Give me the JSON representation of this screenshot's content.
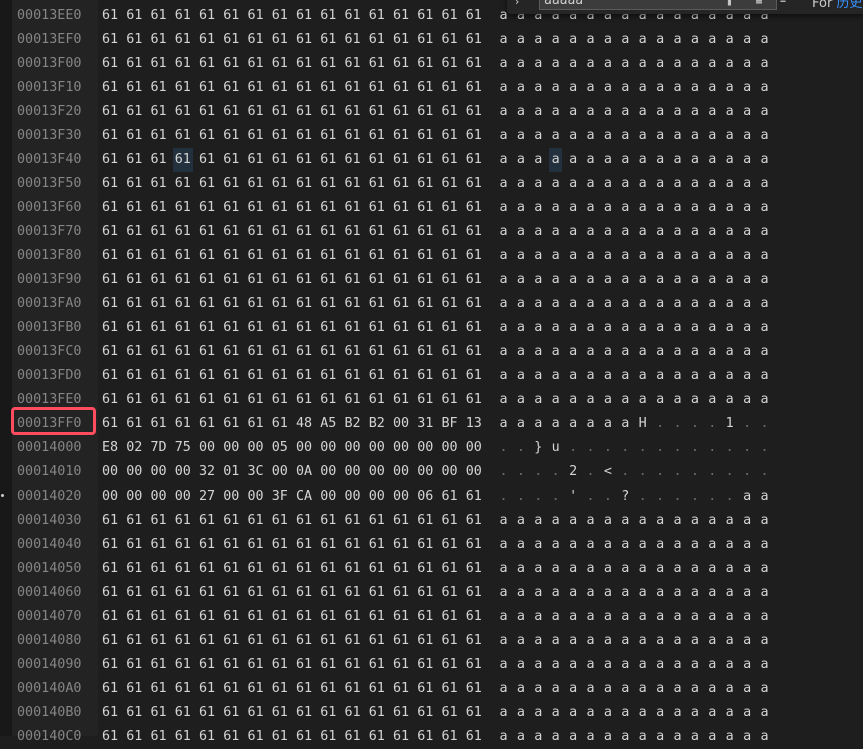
{
  "find": {
    "query": "aaaaa",
    "label_prefix": "For ",
    "label_accent": "历史"
  },
  "highlight_address": "00013FF0",
  "selected_offset": "00013F43",
  "rows": [
    {
      "addr": "00013EE0",
      "hex": [
        "61",
        "61",
        "61",
        "61",
        "61",
        "61",
        "61",
        "61",
        "61",
        "61",
        "61",
        "61",
        "61",
        "61",
        "61",
        "61"
      ],
      "ascii": [
        "a",
        "a",
        "a",
        "a",
        "a",
        "a",
        "a",
        "a",
        "a",
        "a",
        "a",
        "a",
        "a",
        "a",
        "a",
        "a"
      ]
    },
    {
      "addr": "00013EF0",
      "hex": [
        "61",
        "61",
        "61",
        "61",
        "61",
        "61",
        "61",
        "61",
        "61",
        "61",
        "61",
        "61",
        "61",
        "61",
        "61",
        "61"
      ],
      "ascii": [
        "a",
        "a",
        "a",
        "a",
        "a",
        "a",
        "a",
        "a",
        "a",
        "a",
        "a",
        "a",
        "a",
        "a",
        "a",
        "a"
      ]
    },
    {
      "addr": "00013F00",
      "hex": [
        "61",
        "61",
        "61",
        "61",
        "61",
        "61",
        "61",
        "61",
        "61",
        "61",
        "61",
        "61",
        "61",
        "61",
        "61",
        "61"
      ],
      "ascii": [
        "a",
        "a",
        "a",
        "a",
        "a",
        "a",
        "a",
        "a",
        "a",
        "a",
        "a",
        "a",
        "a",
        "a",
        "a",
        "a"
      ]
    },
    {
      "addr": "00013F10",
      "hex": [
        "61",
        "61",
        "61",
        "61",
        "61",
        "61",
        "61",
        "61",
        "61",
        "61",
        "61",
        "61",
        "61",
        "61",
        "61",
        "61"
      ],
      "ascii": [
        "a",
        "a",
        "a",
        "a",
        "a",
        "a",
        "a",
        "a",
        "a",
        "a",
        "a",
        "a",
        "a",
        "a",
        "a",
        "a"
      ]
    },
    {
      "addr": "00013F20",
      "hex": [
        "61",
        "61",
        "61",
        "61",
        "61",
        "61",
        "61",
        "61",
        "61",
        "61",
        "61",
        "61",
        "61",
        "61",
        "61",
        "61"
      ],
      "ascii": [
        "a",
        "a",
        "a",
        "a",
        "a",
        "a",
        "a",
        "a",
        "a",
        "a",
        "a",
        "a",
        "a",
        "a",
        "a",
        "a"
      ]
    },
    {
      "addr": "00013F30",
      "hex": [
        "61",
        "61",
        "61",
        "61",
        "61",
        "61",
        "61",
        "61",
        "61",
        "61",
        "61",
        "61",
        "61",
        "61",
        "61",
        "61"
      ],
      "ascii": [
        "a",
        "a",
        "a",
        "a",
        "a",
        "a",
        "a",
        "a",
        "a",
        "a",
        "a",
        "a",
        "a",
        "a",
        "a",
        "a"
      ]
    },
    {
      "addr": "00013F40",
      "hex": [
        "61",
        "61",
        "61",
        "61",
        "61",
        "61",
        "61",
        "61",
        "61",
        "61",
        "61",
        "61",
        "61",
        "61",
        "61",
        "61"
      ],
      "ascii": [
        "a",
        "a",
        "a",
        "a",
        "a",
        "a",
        "a",
        "a",
        "a",
        "a",
        "a",
        "a",
        "a",
        "a",
        "a",
        "a"
      ]
    },
    {
      "addr": "00013F50",
      "hex": [
        "61",
        "61",
        "61",
        "61",
        "61",
        "61",
        "61",
        "61",
        "61",
        "61",
        "61",
        "61",
        "61",
        "61",
        "61",
        "61"
      ],
      "ascii": [
        "a",
        "a",
        "a",
        "a",
        "a",
        "a",
        "a",
        "a",
        "a",
        "a",
        "a",
        "a",
        "a",
        "a",
        "a",
        "a"
      ]
    },
    {
      "addr": "00013F60",
      "hex": [
        "61",
        "61",
        "61",
        "61",
        "61",
        "61",
        "61",
        "61",
        "61",
        "61",
        "61",
        "61",
        "61",
        "61",
        "61",
        "61"
      ],
      "ascii": [
        "a",
        "a",
        "a",
        "a",
        "a",
        "a",
        "a",
        "a",
        "a",
        "a",
        "a",
        "a",
        "a",
        "a",
        "a",
        "a"
      ]
    },
    {
      "addr": "00013F70",
      "hex": [
        "61",
        "61",
        "61",
        "61",
        "61",
        "61",
        "61",
        "61",
        "61",
        "61",
        "61",
        "61",
        "61",
        "61",
        "61",
        "61"
      ],
      "ascii": [
        "a",
        "a",
        "a",
        "a",
        "a",
        "a",
        "a",
        "a",
        "a",
        "a",
        "a",
        "a",
        "a",
        "a",
        "a",
        "a"
      ]
    },
    {
      "addr": "00013F80",
      "hex": [
        "61",
        "61",
        "61",
        "61",
        "61",
        "61",
        "61",
        "61",
        "61",
        "61",
        "61",
        "61",
        "61",
        "61",
        "61",
        "61"
      ],
      "ascii": [
        "a",
        "a",
        "a",
        "a",
        "a",
        "a",
        "a",
        "a",
        "a",
        "a",
        "a",
        "a",
        "a",
        "a",
        "a",
        "a"
      ]
    },
    {
      "addr": "00013F90",
      "hex": [
        "61",
        "61",
        "61",
        "61",
        "61",
        "61",
        "61",
        "61",
        "61",
        "61",
        "61",
        "61",
        "61",
        "61",
        "61",
        "61"
      ],
      "ascii": [
        "a",
        "a",
        "a",
        "a",
        "a",
        "a",
        "a",
        "a",
        "a",
        "a",
        "a",
        "a",
        "a",
        "a",
        "a",
        "a"
      ]
    },
    {
      "addr": "00013FA0",
      "hex": [
        "61",
        "61",
        "61",
        "61",
        "61",
        "61",
        "61",
        "61",
        "61",
        "61",
        "61",
        "61",
        "61",
        "61",
        "61",
        "61"
      ],
      "ascii": [
        "a",
        "a",
        "a",
        "a",
        "a",
        "a",
        "a",
        "a",
        "a",
        "a",
        "a",
        "a",
        "a",
        "a",
        "a",
        "a"
      ]
    },
    {
      "addr": "00013FB0",
      "hex": [
        "61",
        "61",
        "61",
        "61",
        "61",
        "61",
        "61",
        "61",
        "61",
        "61",
        "61",
        "61",
        "61",
        "61",
        "61",
        "61"
      ],
      "ascii": [
        "a",
        "a",
        "a",
        "a",
        "a",
        "a",
        "a",
        "a",
        "a",
        "a",
        "a",
        "a",
        "a",
        "a",
        "a",
        "a"
      ]
    },
    {
      "addr": "00013FC0",
      "hex": [
        "61",
        "61",
        "61",
        "61",
        "61",
        "61",
        "61",
        "61",
        "61",
        "61",
        "61",
        "61",
        "61",
        "61",
        "61",
        "61"
      ],
      "ascii": [
        "a",
        "a",
        "a",
        "a",
        "a",
        "a",
        "a",
        "a",
        "a",
        "a",
        "a",
        "a",
        "a",
        "a",
        "a",
        "a"
      ]
    },
    {
      "addr": "00013FD0",
      "hex": [
        "61",
        "61",
        "61",
        "61",
        "61",
        "61",
        "61",
        "61",
        "61",
        "61",
        "61",
        "61",
        "61",
        "61",
        "61",
        "61"
      ],
      "ascii": [
        "a",
        "a",
        "a",
        "a",
        "a",
        "a",
        "a",
        "a",
        "a",
        "a",
        "a",
        "a",
        "a",
        "a",
        "a",
        "a"
      ]
    },
    {
      "addr": "00013FE0",
      "hex": [
        "61",
        "61",
        "61",
        "61",
        "61",
        "61",
        "61",
        "61",
        "61",
        "61",
        "61",
        "61",
        "61",
        "61",
        "61",
        "61"
      ],
      "ascii": [
        "a",
        "a",
        "a",
        "a",
        "a",
        "a",
        "a",
        "a",
        "a",
        "a",
        "a",
        "a",
        "a",
        "a",
        "a",
        "a"
      ]
    },
    {
      "addr": "00013FF0",
      "hex": [
        "61",
        "61",
        "61",
        "61",
        "61",
        "61",
        "61",
        "61",
        "48",
        "A5",
        "B2",
        "B2",
        "00",
        "31",
        "BF",
        "13"
      ],
      "ascii": [
        "a",
        "a",
        "a",
        "a",
        "a",
        "a",
        "a",
        "a",
        "H",
        ".",
        ".",
        ".",
        ".",
        "1",
        ".",
        "."
      ]
    },
    {
      "addr": "00014000",
      "hex": [
        "E8",
        "02",
        "7D",
        "75",
        "00",
        "00",
        "00",
        "05",
        "00",
        "00",
        "00",
        "00",
        "00",
        "00",
        "00",
        "00"
      ],
      "ascii": [
        ".",
        ".",
        "}",
        "u",
        ".",
        ".",
        ".",
        ".",
        ".",
        ".",
        ".",
        ".",
        ".",
        ".",
        ".",
        "."
      ]
    },
    {
      "addr": "00014010",
      "hex": [
        "00",
        "00",
        "00",
        "00",
        "32",
        "01",
        "3C",
        "00",
        "0A",
        "00",
        "00",
        "00",
        "00",
        "00",
        "00",
        "00"
      ],
      "ascii": [
        ".",
        ".",
        ".",
        ".",
        "2",
        ".",
        "<",
        ".",
        ".",
        ".",
        ".",
        ".",
        ".",
        ".",
        ".",
        "."
      ]
    },
    {
      "addr": "00014020",
      "hex": [
        "00",
        "00",
        "00",
        "00",
        "27",
        "00",
        "00",
        "3F",
        "CA",
        "00",
        "00",
        "00",
        "00",
        "06",
        "61",
        "61"
      ],
      "ascii": [
        ".",
        ".",
        ".",
        ".",
        "'",
        ".",
        ".",
        "?",
        ".",
        ".",
        ".",
        ".",
        ".",
        ".",
        "a",
        "a"
      ]
    },
    {
      "addr": "00014030",
      "hex": [
        "61",
        "61",
        "61",
        "61",
        "61",
        "61",
        "61",
        "61",
        "61",
        "61",
        "61",
        "61",
        "61",
        "61",
        "61",
        "61"
      ],
      "ascii": [
        "a",
        "a",
        "a",
        "a",
        "a",
        "a",
        "a",
        "a",
        "a",
        "a",
        "a",
        "a",
        "a",
        "a",
        "a",
        "a"
      ]
    },
    {
      "addr": "00014040",
      "hex": [
        "61",
        "61",
        "61",
        "61",
        "61",
        "61",
        "61",
        "61",
        "61",
        "61",
        "61",
        "61",
        "61",
        "61",
        "61",
        "61"
      ],
      "ascii": [
        "a",
        "a",
        "a",
        "a",
        "a",
        "a",
        "a",
        "a",
        "a",
        "a",
        "a",
        "a",
        "a",
        "a",
        "a",
        "a"
      ]
    },
    {
      "addr": "00014050",
      "hex": [
        "61",
        "61",
        "61",
        "61",
        "61",
        "61",
        "61",
        "61",
        "61",
        "61",
        "61",
        "61",
        "61",
        "61",
        "61",
        "61"
      ],
      "ascii": [
        "a",
        "a",
        "a",
        "a",
        "a",
        "a",
        "a",
        "a",
        "a",
        "a",
        "a",
        "a",
        "a",
        "a",
        "a",
        "a"
      ]
    },
    {
      "addr": "00014060",
      "hex": [
        "61",
        "61",
        "61",
        "61",
        "61",
        "61",
        "61",
        "61",
        "61",
        "61",
        "61",
        "61",
        "61",
        "61",
        "61",
        "61"
      ],
      "ascii": [
        "a",
        "a",
        "a",
        "a",
        "a",
        "a",
        "a",
        "a",
        "a",
        "a",
        "a",
        "a",
        "a",
        "a",
        "a",
        "a"
      ]
    },
    {
      "addr": "00014070",
      "hex": [
        "61",
        "61",
        "61",
        "61",
        "61",
        "61",
        "61",
        "61",
        "61",
        "61",
        "61",
        "61",
        "61",
        "61",
        "61",
        "61"
      ],
      "ascii": [
        "a",
        "a",
        "a",
        "a",
        "a",
        "a",
        "a",
        "a",
        "a",
        "a",
        "a",
        "a",
        "a",
        "a",
        "a",
        "a"
      ]
    },
    {
      "addr": "00014080",
      "hex": [
        "61",
        "61",
        "61",
        "61",
        "61",
        "61",
        "61",
        "61",
        "61",
        "61",
        "61",
        "61",
        "61",
        "61",
        "61",
        "61"
      ],
      "ascii": [
        "a",
        "a",
        "a",
        "a",
        "a",
        "a",
        "a",
        "a",
        "a",
        "a",
        "a",
        "a",
        "a",
        "a",
        "a",
        "a"
      ]
    },
    {
      "addr": "00014090",
      "hex": [
        "61",
        "61",
        "61",
        "61",
        "61",
        "61",
        "61",
        "61",
        "61",
        "61",
        "61",
        "61",
        "61",
        "61",
        "61",
        "61"
      ],
      "ascii": [
        "a",
        "a",
        "a",
        "a",
        "a",
        "a",
        "a",
        "a",
        "a",
        "a",
        "a",
        "a",
        "a",
        "a",
        "a",
        "a"
      ]
    },
    {
      "addr": "000140A0",
      "hex": [
        "61",
        "61",
        "61",
        "61",
        "61",
        "61",
        "61",
        "61",
        "61",
        "61",
        "61",
        "61",
        "61",
        "61",
        "61",
        "61"
      ],
      "ascii": [
        "a",
        "a",
        "a",
        "a",
        "a",
        "a",
        "a",
        "a",
        "a",
        "a",
        "a",
        "a",
        "a",
        "a",
        "a",
        "a"
      ]
    },
    {
      "addr": "000140B0",
      "hex": [
        "61",
        "61",
        "61",
        "61",
        "61",
        "61",
        "61",
        "61",
        "61",
        "61",
        "61",
        "61",
        "61",
        "61",
        "61",
        "61"
      ],
      "ascii": [
        "a",
        "a",
        "a",
        "a",
        "a",
        "a",
        "a",
        "a",
        "a",
        "a",
        "a",
        "a",
        "a",
        "a",
        "a",
        "a"
      ]
    },
    {
      "addr": "000140C0",
      "hex": [
        "61",
        "61",
        "61",
        "61",
        "61",
        "61",
        "61",
        "61",
        "61",
        "61",
        "61",
        "61",
        "61",
        "61",
        "61",
        "61"
      ],
      "ascii": [
        "a",
        "a",
        "a",
        "a",
        "a",
        "a",
        "a",
        "a",
        "a",
        "a",
        "a",
        "a",
        "a",
        "a",
        "a",
        "a"
      ]
    }
  ]
}
